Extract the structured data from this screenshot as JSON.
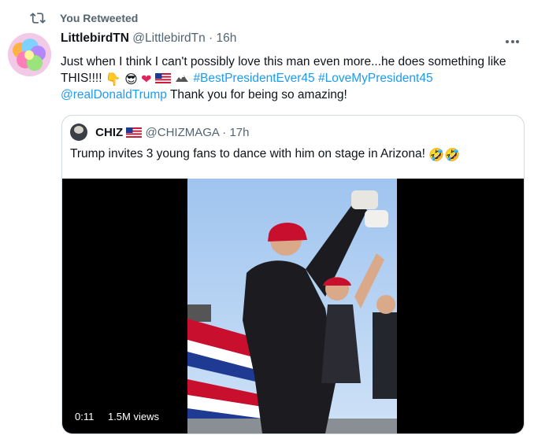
{
  "retweet": {
    "label": "You Retweeted"
  },
  "tweet": {
    "display_name": "LittlebirdTN",
    "handle": "@LittlebirdTn",
    "separator": "·",
    "time": "16h",
    "text_part1": "Just when I think I can't possibly love this man even more...he does something like THIS!!!!",
    "emojis": [
      "👇",
      "😎",
      "❤"
    ],
    "hashtag1": "#BestPresidentEver45",
    "hashtag2": "#LoveMyPresident45",
    "mention": "@realDonaldTrump",
    "text_part2": "Thank you for being so amazing!"
  },
  "quoted_tweet": {
    "display_name": "CHIZ",
    "handle": "@CHIZMAGA",
    "separator": "·",
    "time": "17h",
    "text": "Trump invites 3 young fans to dance with him on stage in Arizona!",
    "emojis": [
      "🤣",
      "🤣"
    ]
  },
  "video": {
    "duration": "0:11",
    "views": "1.5M views"
  },
  "colors": {
    "link": "#1d9bf0",
    "muted": "#536471",
    "border": "#cfd9de"
  }
}
